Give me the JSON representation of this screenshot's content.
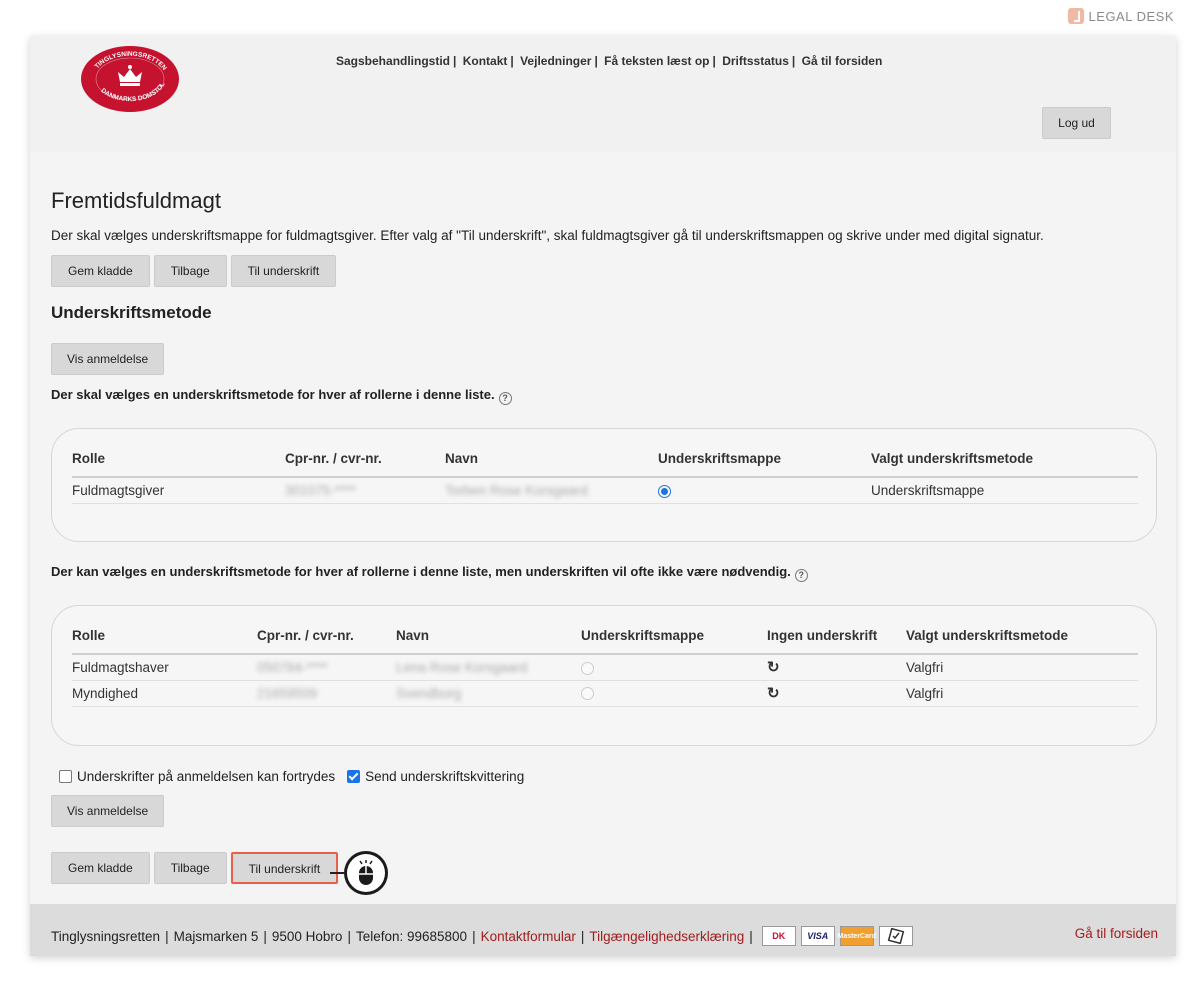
{
  "brand": {
    "name": "LEGAL DESK"
  },
  "header": {
    "nav": [
      "Sagsbehandlingstid",
      "Kontakt",
      "Vejledninger",
      "Få teksten læst op",
      "Driftsstatus",
      "Gå til forsiden"
    ],
    "logout": "Log ud",
    "logo": {
      "top": "TINGLYSNINGSRETTEN",
      "bottom": "DANMARKS DOMSTOLE"
    }
  },
  "page": {
    "title": "Fremtidsfuldmagt",
    "intro": "Der skal vælges underskriftsmappe for fuldmagtsgiver. Efter valg af \"Til underskrift\", skal fuldmagtsgiver gå til underskriftsmappen og skrive under med digital signatur.",
    "buttons": {
      "save": "Gem kladde",
      "back": "Tilbage",
      "sign": "Til underskrift",
      "preview": "Vis anmeldelse"
    },
    "section_title": "Underskriftsmetode",
    "required_label": "Der skal vælges en underskriftsmetode for hver af rollerne i denne liste.",
    "optional_label": "Der kan vælges en underskriftsmetode for hver af rollerne i denne liste, men underskriften vil ofte ikke være nødvendig."
  },
  "table1": {
    "headers": [
      "Rolle",
      "Cpr-nr. / cvr-nr.",
      "Navn",
      "Underskriftsmappe",
      "Valgt underskriftsmetode"
    ],
    "rows": [
      {
        "rolle": "Fuldmagtsgiver",
        "cpr": "301075-****",
        "navn": "Torben Rose Korsgaard",
        "mappe_selected": true,
        "metode": "Underskriftsmappe"
      }
    ]
  },
  "table2": {
    "headers": [
      "Rolle",
      "Cpr-nr. / cvr-nr.",
      "Navn",
      "Underskriftsmappe",
      "Ingen underskrift",
      "Valgt underskriftsmetode"
    ],
    "rows": [
      {
        "rolle": "Fuldmagtshaver",
        "cpr": "050784-****",
        "navn": "Lena Rose Korsgaard",
        "metode": "Valgfri"
      },
      {
        "rolle": "Myndighed",
        "cpr": "21659509",
        "navn": "Svendborg",
        "metode": "Valgfri"
      }
    ]
  },
  "checks": {
    "revocable": {
      "label": "Underskrifter på anmeldelsen kan fortrydes",
      "checked": false
    },
    "receipt": {
      "label": "Send underskriftskvittering",
      "checked": true
    }
  },
  "footer": {
    "org": "Tinglysningsretten",
    "address": "Majsmarken 5",
    "city": "9500 Hobro",
    "phone": "Telefon: 99685800",
    "contact_link": "Kontaktformular",
    "access_link": "Tilgængelighedserklæring",
    "cards": [
      "DK",
      "VISA",
      "MasterCard",
      "secure"
    ],
    "home_link": "Gå til forsiden"
  }
}
